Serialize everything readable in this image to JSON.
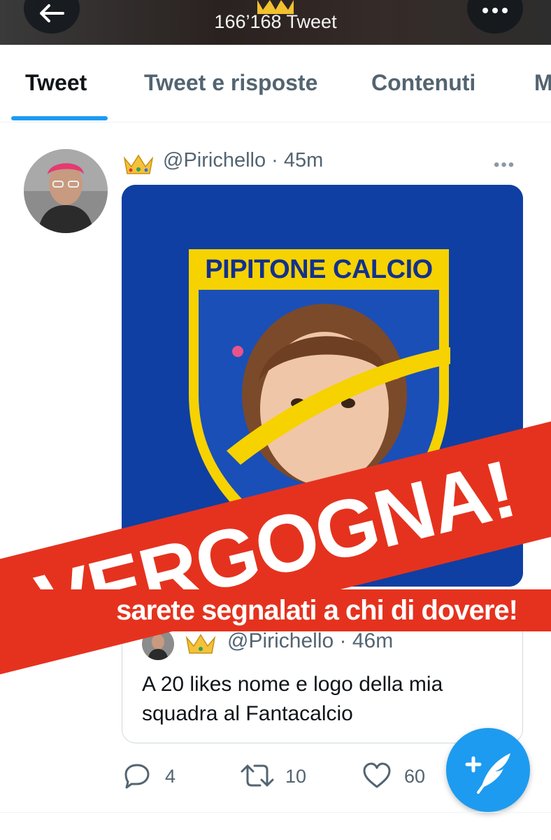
{
  "header": {
    "tweet_count": "166’168 Tweet"
  },
  "tabs": [
    {
      "label": "Tweet"
    },
    {
      "label": "Tweet e risposte"
    },
    {
      "label": "Contenuti"
    },
    {
      "label": "M"
    }
  ],
  "tweet": {
    "username": "@Pirichello",
    "time": "45m",
    "meta": "@Pirichello · 45m",
    "image": {
      "crest_text": "PIPITONE CALCIO"
    },
    "quoted": {
      "meta": "@Pirichello · 46m",
      "text": "A 20 likes nome e logo della mia squadra al Fantacalcio"
    },
    "actions": {
      "replies": "4",
      "retweets": "10",
      "likes": "60"
    }
  },
  "overlay": {
    "headline": "VERGOGNA!",
    "subline": "sarete segnalati a chi di dovere!"
  },
  "colors": {
    "accent": "#1d9bf0",
    "banner": "#e5321e",
    "crest_blue": "#0f3fa2",
    "crest_yellow": "#f6d200"
  }
}
